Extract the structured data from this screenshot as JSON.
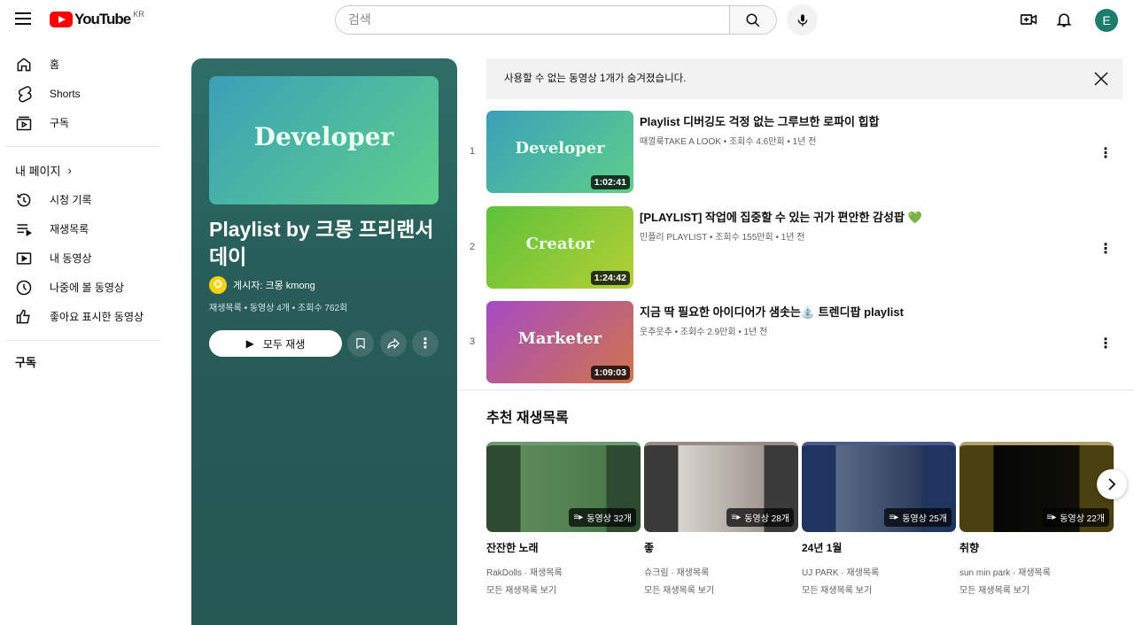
{
  "header": {
    "logo": "YouTube",
    "country": "KR",
    "search_placeholder": "검색",
    "avatar_letter": "E"
  },
  "sidebar": {
    "main": [
      {
        "label": "홈"
      },
      {
        "label": "Shorts"
      },
      {
        "label": "구독"
      }
    ],
    "my_page": "내 페이지",
    "my_items": [
      {
        "label": "시청 기록"
      },
      {
        "label": "재생목록"
      },
      {
        "label": "내 동영상"
      },
      {
        "label": "나중에 볼 동영상"
      },
      {
        "label": "좋아요 표시한 동영상"
      }
    ],
    "subs_heading": "구독"
  },
  "playlist": {
    "thumb_text": "Developer",
    "title": "Playlist by 크몽 프리랜서 데이",
    "owner": "게시자: 크몽 kmong",
    "meta": "재생목록 • 동영상 4개 • 조회수 762회",
    "play_all": "모두 재생"
  },
  "notice": "사용할 수 없는 동영상 1개가 숨겨졌습니다.",
  "videos": [
    {
      "index": "1",
      "thumb_text": "Developer",
      "duration": "1:02:41",
      "title": "Playlist 디버깅도 걱정 없는 그루브한 로파이 힙합",
      "meta": "때껄룩TAKE A LOOK • 조회수 4.6만회 • 1년 전"
    },
    {
      "index": "2",
      "thumb_text": "Creator",
      "duration": "1:24:42",
      "title": "[PLAYLIST] 작업에 집중할 수 있는 귀가 편안한 감성팝 💚",
      "meta": "민플리 PLAYLIST • 조회수 155만회 • 1년 전"
    },
    {
      "index": "3",
      "thumb_text": "Marketer",
      "duration": "1:09:03",
      "title": "지금 딱 필요한 아이디어가 샘솟는⛲ 트렌디팝 playlist",
      "meta": "웃추웃추 • 조회수 2.9만회 • 1년 전"
    }
  ],
  "recommended": {
    "heading": "추천 재생목록",
    "cards": [
      {
        "count": "동영상 32개",
        "title": "잔잔한 노래",
        "channel": "RakDolls · 재생목록",
        "view_all": "모든 재생목록 보기"
      },
      {
        "count": "동영상 28개",
        "title": "좋",
        "channel": "슈크림 · 재생목록",
        "view_all": "모든 재생목록 보기"
      },
      {
        "count": "동영상 25개",
        "title": "24년 1월",
        "channel": "UJ PARK · 재생목록",
        "view_all": "모든 재생목록 보기"
      },
      {
        "count": "동영상 22개",
        "title": "취향",
        "channel": "sun min park · 재생목록",
        "view_all": "모든 재생목록 보기"
      }
    ]
  }
}
